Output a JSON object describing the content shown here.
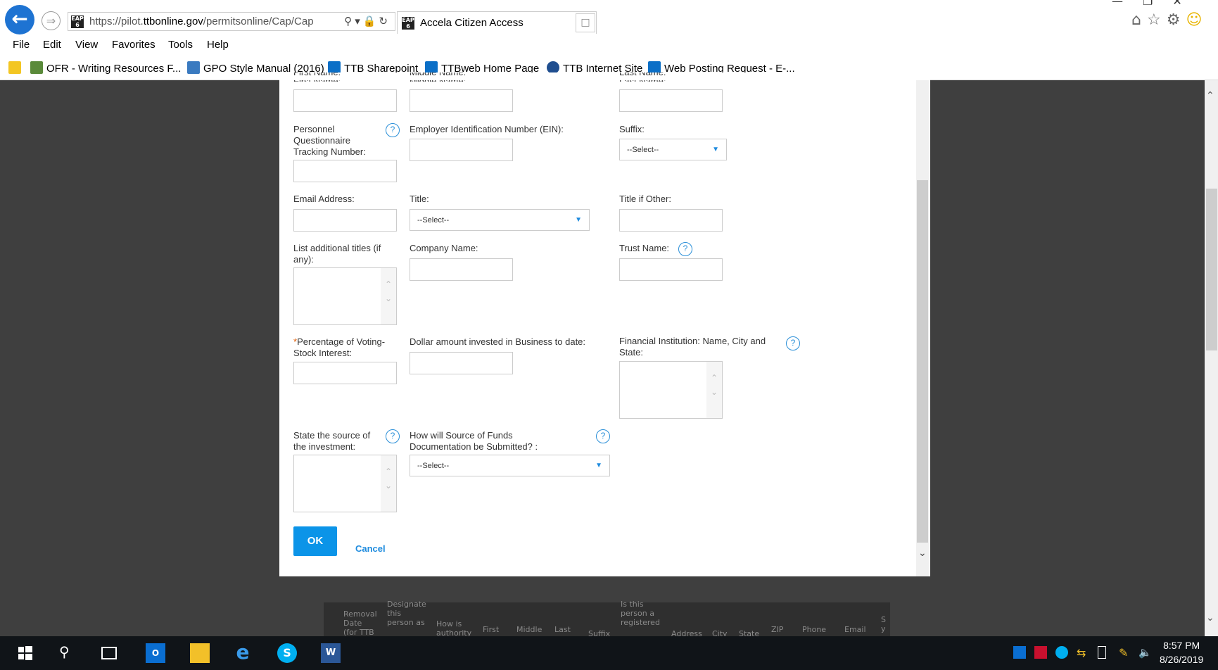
{
  "browser": {
    "url_prefix": "https://pilot.",
    "url_domain": "ttbonline.gov",
    "url_rest": "/permitsonline/Cap/Cap",
    "tab_title": "Accela Citizen Access",
    "favicon_text": "EAP 6"
  },
  "menu": [
    "File",
    "Edit",
    "View",
    "Favorites",
    "Tools",
    "Help"
  ],
  "favorites": [
    "OFR - Writing Resources F...",
    "GPO Style Manual (2016)",
    "TTB Sharepoint",
    "TTBweb Home Page",
    "TTB Internet Site",
    "Web Posting Request - E-..."
  ],
  "form": {
    "first_name": "First Name:",
    "middle_name": "Middle Name:",
    "last_name": "Last Name:",
    "pq_tracking": "Personnel Questionnaire Tracking Number:",
    "ein": "Employer Identification Number (EIN):",
    "suffix": "Suffix:",
    "suffix_value": "--Select--",
    "email": "Email Address:",
    "title": "Title:",
    "title_value": "--Select--",
    "title_other": "Title if Other:",
    "additional_titles": "List additional titles (if any):",
    "company": "Company Name:",
    "trust": "Trust Name:",
    "required_mark": "*",
    "voting_stock": "Percentage of Voting-Stock Interest:",
    "dollar_amount": "Dollar amount invested in Business to date:",
    "financial_institution": "Financial Institution: Name, City and State:",
    "source_investment": "State the source of the investment:",
    "source_funds": "How will Source of Funds Documentation be Submitted? :",
    "source_funds_value": "--Select--",
    "ok": "OK",
    "cancel": "Cancel",
    "help_glyph": "?"
  },
  "background_table": [
    "Removal Date (for TTB",
    "Designate this person as",
    "How is authority",
    "First",
    "Middle",
    "Last",
    "Suffix",
    "Is this person a registered",
    "Address",
    "City",
    "State",
    "ZIP",
    "Phone",
    "Email",
    "S y"
  ],
  "clock": {
    "time": "8:57 PM",
    "date": "8/26/2019"
  }
}
